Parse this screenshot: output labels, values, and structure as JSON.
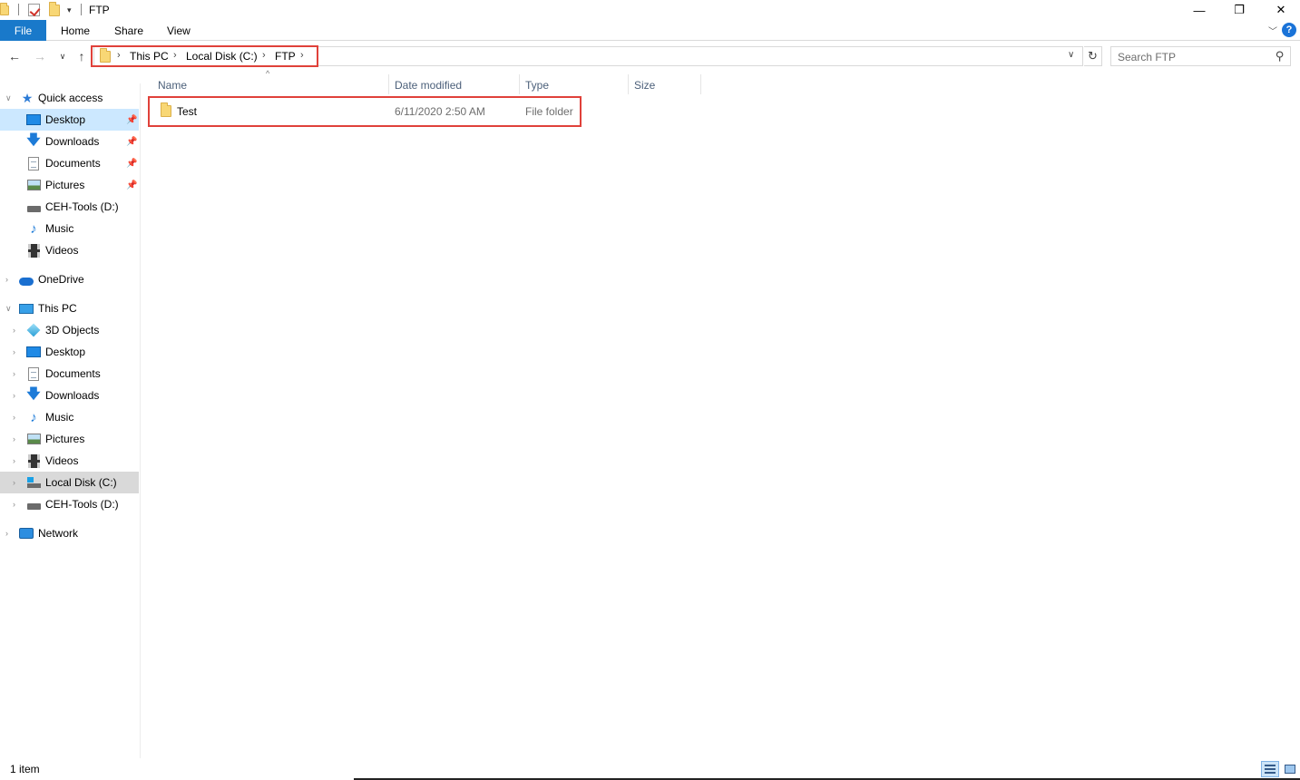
{
  "window": {
    "title": "FTP",
    "minimize": "—",
    "restore": "❐",
    "close": "✕"
  },
  "ribbon": {
    "tabs": [
      {
        "label": "File"
      },
      {
        "label": "Home"
      },
      {
        "label": "Share"
      },
      {
        "label": "View"
      }
    ],
    "help": "?"
  },
  "address": {
    "crumbs": [
      "This PC",
      "Local Disk (C:)",
      "FTP"
    ],
    "search_placeholder": "Search FTP"
  },
  "sidebar": {
    "quick_access": {
      "label": "Quick access",
      "items": [
        {
          "label": "Desktop",
          "icon": "desktop-icon",
          "pinned": true
        },
        {
          "label": "Downloads",
          "icon": "downloads-icon",
          "pinned": true
        },
        {
          "label": "Documents",
          "icon": "documents-icon",
          "pinned": true
        },
        {
          "label": "Pictures",
          "icon": "pictures-icon",
          "pinned": true
        },
        {
          "label": "CEH-Tools (D:)",
          "icon": "drive-icon",
          "pinned": false
        },
        {
          "label": "Music",
          "icon": "music-icon",
          "pinned": false
        },
        {
          "label": "Videos",
          "icon": "videos-icon",
          "pinned": false
        }
      ]
    },
    "onedrive": {
      "label": "OneDrive"
    },
    "this_pc": {
      "label": "This PC",
      "items": [
        {
          "label": "3D Objects",
          "icon": "3d-objects-icon"
        },
        {
          "label": "Desktop",
          "icon": "desktop-icon"
        },
        {
          "label": "Documents",
          "icon": "documents-icon"
        },
        {
          "label": "Downloads",
          "icon": "downloads-icon"
        },
        {
          "label": "Music",
          "icon": "music-icon"
        },
        {
          "label": "Pictures",
          "icon": "pictures-icon"
        },
        {
          "label": "Videos",
          "icon": "videos-icon"
        },
        {
          "label": "Local Disk (C:)",
          "icon": "local-disk-icon"
        },
        {
          "label": "CEH-Tools (D:)",
          "icon": "drive-icon"
        }
      ]
    },
    "network": {
      "label": "Network"
    }
  },
  "columns": {
    "name": "Name",
    "date": "Date modified",
    "type": "Type",
    "size": "Size"
  },
  "files": [
    {
      "name": "Test",
      "date": "6/11/2020 2:50 AM",
      "type": "File folder",
      "size": ""
    }
  ],
  "status": {
    "count": "1 item"
  },
  "colors": {
    "accent": "#1979ca",
    "selection": "#cce8ff",
    "highlight_box": "#e0413a"
  }
}
